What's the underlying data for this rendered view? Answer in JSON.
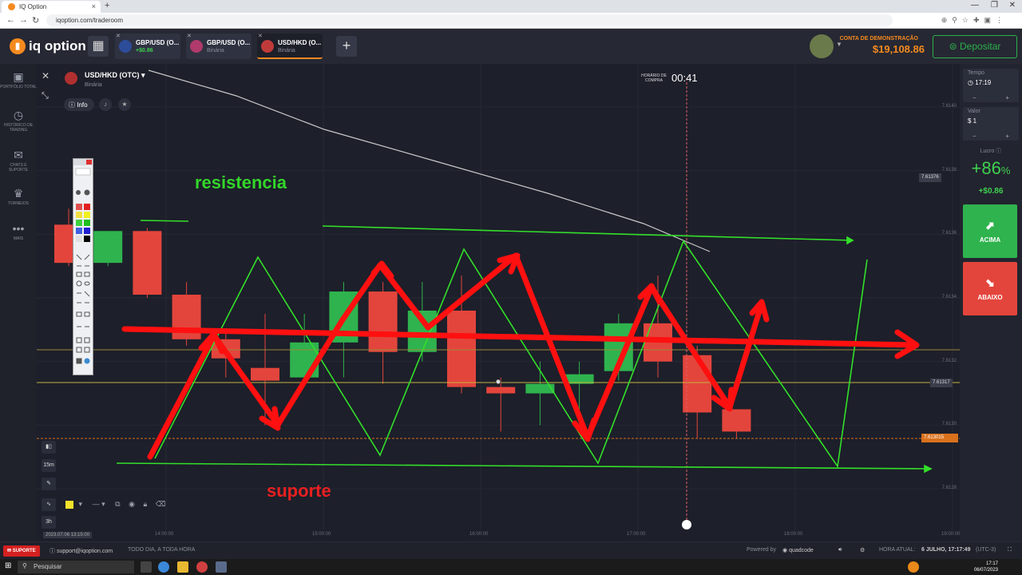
{
  "browser": {
    "tab_title": "IQ Option",
    "url": "iqoption.com/traderoom",
    "new_tab": "+",
    "window_controls": [
      "—",
      "❐",
      "✕"
    ]
  },
  "topbar": {
    "logo_text": "iq option",
    "tabs": [
      {
        "name": "GBP/USD (O...",
        "sub": "+$0.86",
        "accent": "#3fd14f"
      },
      {
        "name": "GBP/USD (O...",
        "sub": "Binária",
        "accent": "#8a8d99"
      },
      {
        "name": "USD/HKD (O...",
        "sub": "Binária",
        "accent": "#8a8d99"
      }
    ],
    "account_label": "CONTA DE DEMONSTRAÇÃO",
    "balance": "$19,108.86",
    "deposit_label": "Depositar"
  },
  "sidebar": {
    "items": [
      {
        "label": "PORTFÓLIO TOTAL",
        "icon": "briefcase-icon",
        "glyph": "▣"
      },
      {
        "label": "HISTÓRICO DE TRADING",
        "icon": "history-icon",
        "glyph": "◷"
      },
      {
        "label": "CHATS E SUPORTE",
        "icon": "chat-icon",
        "glyph": "✉"
      },
      {
        "label": "TORNEIOS",
        "icon": "trophy-icon",
        "glyph": "♛"
      },
      {
        "label": "MAIS",
        "icon": "more-icon",
        "glyph": "•••"
      }
    ]
  },
  "chart": {
    "pair": "USD/HKD (OTC)",
    "pair_type": "Binária",
    "info_label": "Info",
    "purchase_time_label": "HORÁRIO DE COMPRA",
    "purchase_timer": "00:41",
    "annotation_resistance": "resistencia",
    "annotation_support": "suporte",
    "timeframe": "15m",
    "period": "3h",
    "date_label": "2023.07.06 13:15:00",
    "price_tags": {
      "upper": "7.61376",
      "current": "7.61317",
      "strike": "7.613015"
    }
  },
  "chart_data": {
    "type": "candlestick",
    "y_ticks": [
      "7.6140",
      "7.6138",
      "7.6136",
      "7.6134",
      "7.6132",
      "7.6130",
      "7.6128"
    ],
    "x_ticks": [
      "14:00:00",
      "15:00:00",
      "16:00:00",
      "17:00:00",
      "18:00:00",
      "19:00:00"
    ],
    "ylim": [
      7.6127,
      7.6141
    ],
    "candles": [
      {
        "open": 7.61363,
        "close": 7.61351,
        "high": 7.61368,
        "low": 7.6135
      },
      {
        "open": 7.61351,
        "close": 7.61361,
        "high": 7.61361,
        "low": 7.6135
      },
      {
        "open": 7.61361,
        "close": 7.61341,
        "high": 7.61362,
        "low": 7.6134
      },
      {
        "open": 7.61341,
        "close": 7.61327,
        "high": 7.61345,
        "low": 7.61325
      },
      {
        "open": 7.61327,
        "close": 7.61321,
        "high": 7.6133,
        "low": 7.61315
      },
      {
        "open": 7.61318,
        "close": 7.61314,
        "high": 7.61335,
        "low": 7.613
      },
      {
        "open": 7.61315,
        "close": 7.61326,
        "high": 7.61335,
        "low": 7.61315
      },
      {
        "open": 7.61326,
        "close": 7.61342,
        "high": 7.61345,
        "low": 7.61315
      },
      {
        "open": 7.61342,
        "close": 7.61323,
        "high": 7.61345,
        "low": 7.61313
      },
      {
        "open": 7.61323,
        "close": 7.61336,
        "high": 7.61345,
        "low": 7.6132
      },
      {
        "open": 7.61336,
        "close": 7.61312,
        "high": 7.61347,
        "low": 7.6131
      },
      {
        "open": 7.61312,
        "close": 7.6131,
        "high": 7.61315,
        "low": 7.61298
      },
      {
        "open": 7.6131,
        "close": 7.61313,
        "high": 7.6132,
        "low": 7.613
      },
      {
        "open": 7.61313,
        "close": 7.61316,
        "high": 7.6132,
        "low": 7.61305
      },
      {
        "open": 7.61317,
        "close": 7.61332,
        "high": 7.61335,
        "low": 7.61314
      },
      {
        "open": 7.61332,
        "close": 7.6132,
        "high": 7.61347,
        "low": 7.61315
      },
      {
        "open": 7.61322,
        "close": 7.61304,
        "high": 7.61325,
        "low": 7.61296
      },
      {
        "open": 7.61305,
        "close": 7.61298,
        "high": 7.61305,
        "low": 7.61296
      }
    ]
  },
  "right_panel": {
    "time_label": "Tempo",
    "time_value": "17:19",
    "amount_label": "Valor",
    "amount_value": "$ 1",
    "profit_label": "Lucro",
    "profit_pct": "+86",
    "profit_unit": "%",
    "profit_amount": "+$0.86",
    "up_label": "ACIMA",
    "down_label": "ABAIXO",
    "minus": "−",
    "plus": "+"
  },
  "statusbar": {
    "support_label": "SUPORTE",
    "email": "support@iqoption.com",
    "hours": "TODO DIA, A TODA HORA",
    "powered_by": "Powered by",
    "powered_brand": "quadcode",
    "current_time_label": "HORA ATUAL:",
    "current_time": "6 JULHO, 17:17:49",
    "timezone": "(UTC-3)"
  },
  "taskbar": {
    "search_placeholder": "Pesquisar",
    "clock_time": "17:17",
    "clock_date": "06/07/2023"
  },
  "colors": {
    "accent": "#f58a1f",
    "up": "#2fb34e",
    "down": "#e3453c",
    "drawing_green": "#33e02a",
    "drawing_red": "#ff1010"
  }
}
